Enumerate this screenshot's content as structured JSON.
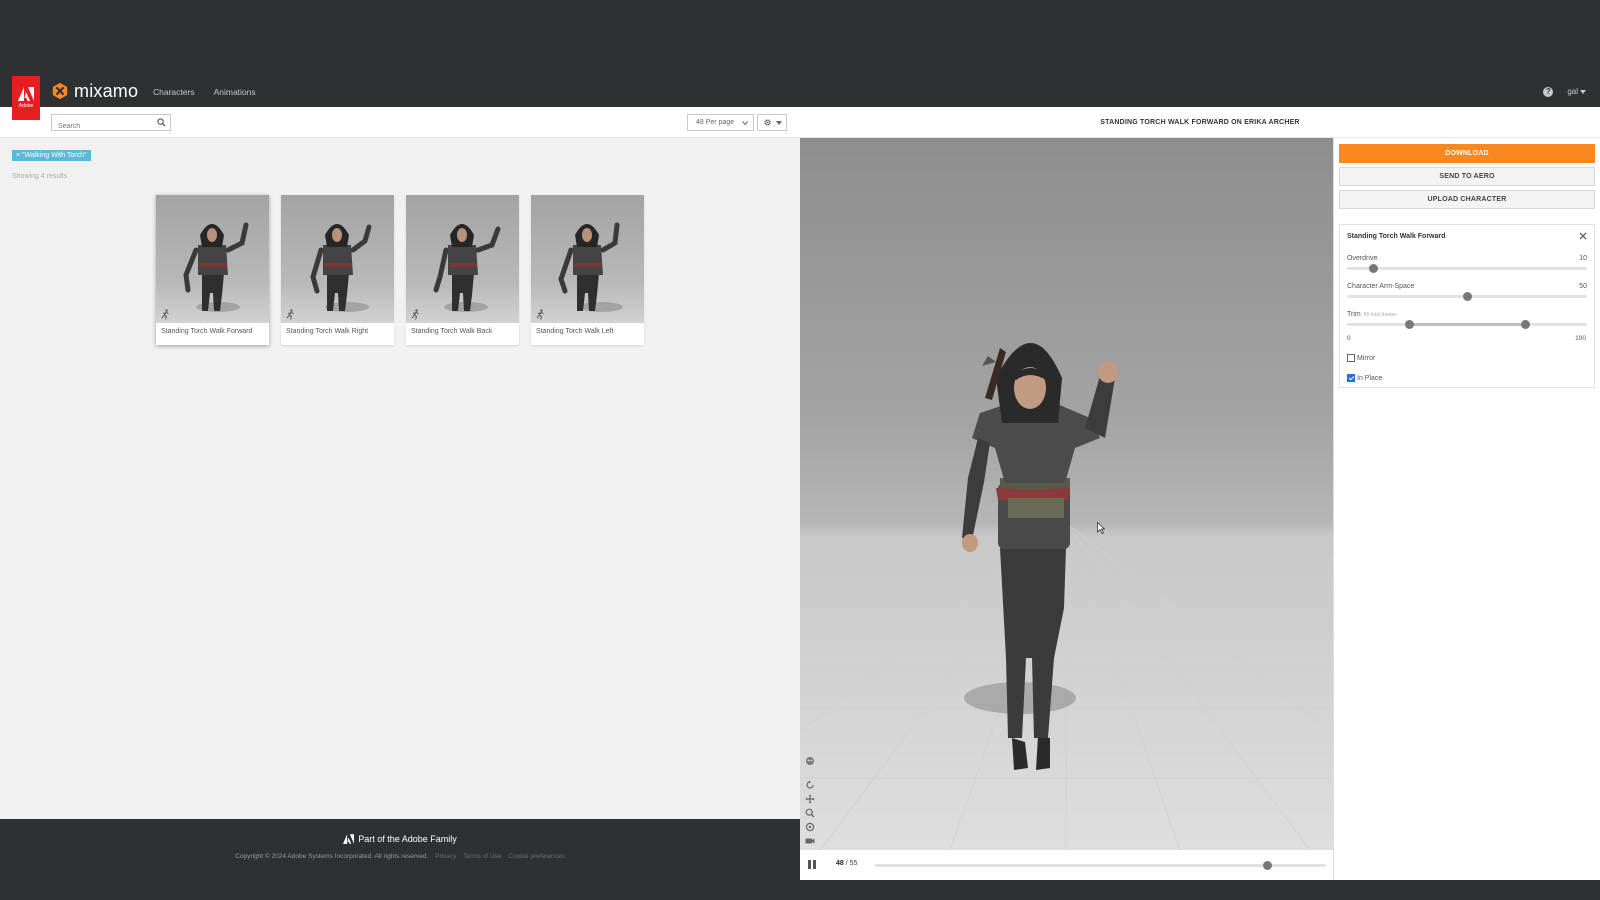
{
  "header": {
    "brand": "mixamo",
    "adobe_word": "Adobe",
    "nav": [
      "Characters",
      "Animations"
    ],
    "user": "gal"
  },
  "toolbar": {
    "search_placeholder": "Search",
    "per_page": "48 Per page"
  },
  "results": {
    "filter_tag": "× \"Walking With Torch\"",
    "showing": "Showing 4 results",
    "cards": [
      {
        "label": "Standing Torch Walk Forward",
        "selected": true
      },
      {
        "label": "Standing Torch Walk Right",
        "selected": false
      },
      {
        "label": "Standing Torch Walk Back",
        "selected": false
      },
      {
        "label": "Standing Torch Walk Left",
        "selected": false
      }
    ]
  },
  "viewer": {
    "title": "STANDING TORCH WALK FORWARD ON ERIKA ARCHER",
    "frame_current": "48",
    "frame_total": "55",
    "progress": 0.87
  },
  "side": {
    "download": "DOWNLOAD",
    "send_to_aero": "SEND TO AERO",
    "upload_character": "UPLOAD CHARACTER",
    "anim_title": "Standing Torch Walk Forward",
    "overdrive": {
      "label": "Overdrive",
      "value": "10",
      "fraction": 0.11
    },
    "arm_space": {
      "label": "Character Arm-Space",
      "value": "50",
      "fraction": 0.5
    },
    "trim": {
      "label": "Trim",
      "note": "56 total frames",
      "min": "0",
      "max": "100",
      "low": 0.26,
      "high": 0.74
    },
    "mirror": {
      "label": "Mirror",
      "checked": false
    },
    "in_place": {
      "label": "In Place",
      "checked": true
    }
  },
  "footer": {
    "family": "Part of the Adobe Family",
    "copyright": "Copyright © 2024 Adobe Systems Incorporated. All rights reserved.",
    "links": [
      "Privacy",
      "Terms of Use",
      "Cookie preferences"
    ]
  },
  "colors": {
    "accent": "#f8881f",
    "adobe_red": "#e51f1f",
    "tag_blue": "#5bb8dd",
    "dark": "#2f3031"
  }
}
